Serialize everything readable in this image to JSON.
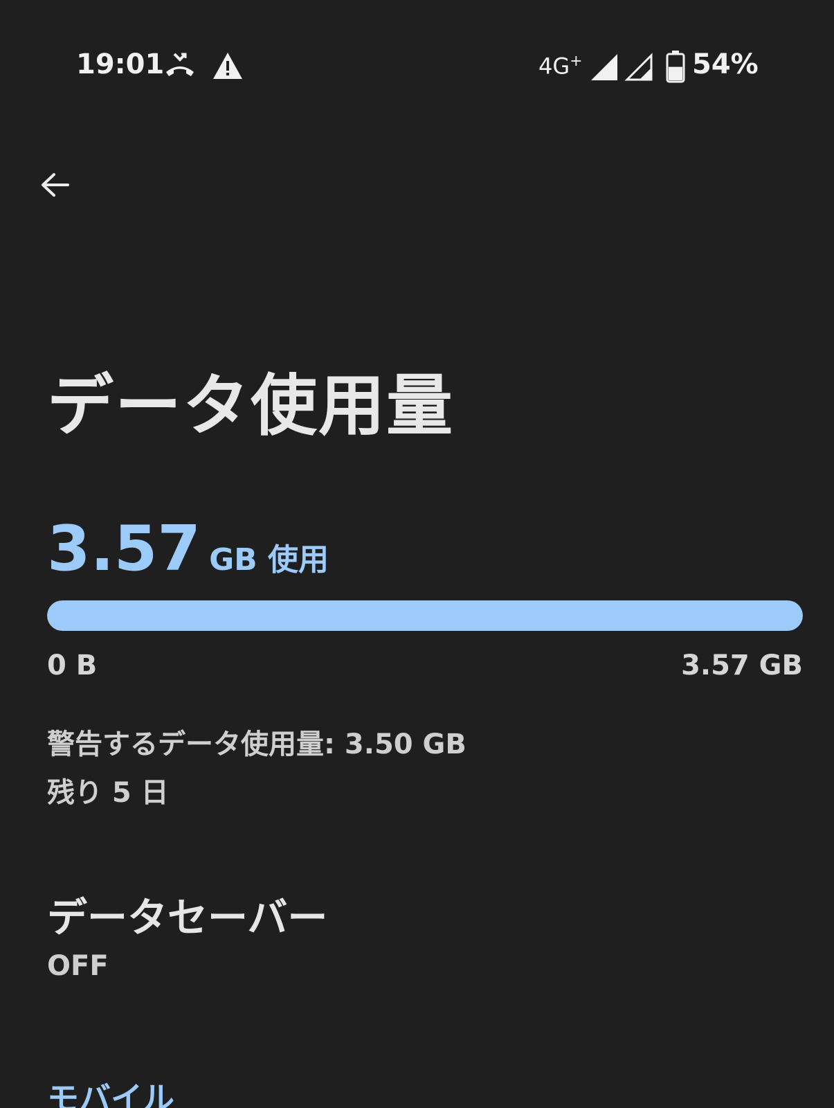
{
  "status_bar": {
    "time": "19:01",
    "network": "4G",
    "network_plus": "+",
    "battery": "54%",
    "battery_level": 0.54
  },
  "page": {
    "title": "データ使用量"
  },
  "usage": {
    "amount": "3.57",
    "unit_label": "GB 使用",
    "progress_fraction": 1.0,
    "range_min": "0 B",
    "range_max": "3.57 GB",
    "warning": "警告するデータ使用量: 3.50 GB",
    "remaining": "残り 5 日"
  },
  "data_saver": {
    "title": "データセーバー",
    "status": "OFF"
  },
  "sections": {
    "mobile": "モバイル"
  },
  "colors": {
    "background": "#1f1f1f",
    "accent": "#9ccbfa"
  }
}
